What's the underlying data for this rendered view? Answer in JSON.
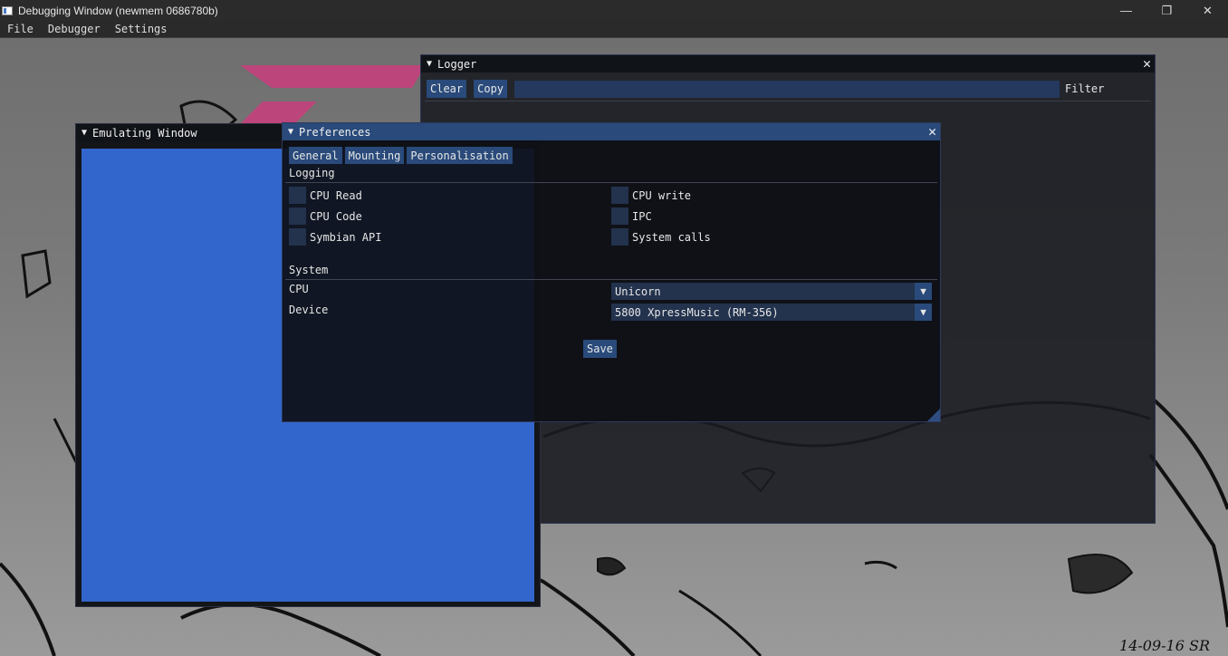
{
  "window": {
    "title": "Debugging Window (newmem 0686780b)",
    "controls": {
      "minimize": "—",
      "maximize": "❐",
      "close": "✕"
    }
  },
  "menu": [
    "File",
    "Debugger",
    "Settings"
  ],
  "logger": {
    "title": "Logger",
    "clear_label": "Clear",
    "copy_label": "Copy",
    "filter_label": "Filter",
    "filter_value": ""
  },
  "emulating": {
    "title": "Emulating Window"
  },
  "preferences": {
    "title": "Preferences",
    "tabs": [
      "General",
      "Mounting",
      "Personalisation"
    ],
    "logging_label": "Logging",
    "checks": [
      {
        "label": "CPU Read",
        "checked": false
      },
      {
        "label": "CPU write",
        "checked": false
      },
      {
        "label": "CPU Code",
        "checked": false
      },
      {
        "label": "IPC",
        "checked": false
      },
      {
        "label": "Symbian API",
        "checked": false
      },
      {
        "label": "System calls",
        "checked": false
      }
    ],
    "system_label": "System",
    "cpu_label": "CPU",
    "cpu_value": "Unicorn",
    "device_label": "Device",
    "device_value": "5800 XpressMusic (RM-356)",
    "save_label": "Save"
  },
  "wallpaper": {
    "signature": "14-09-16 SR"
  },
  "colors": {
    "accent": "#294a7a",
    "screen": "#3366cc",
    "field": "#23324d"
  }
}
